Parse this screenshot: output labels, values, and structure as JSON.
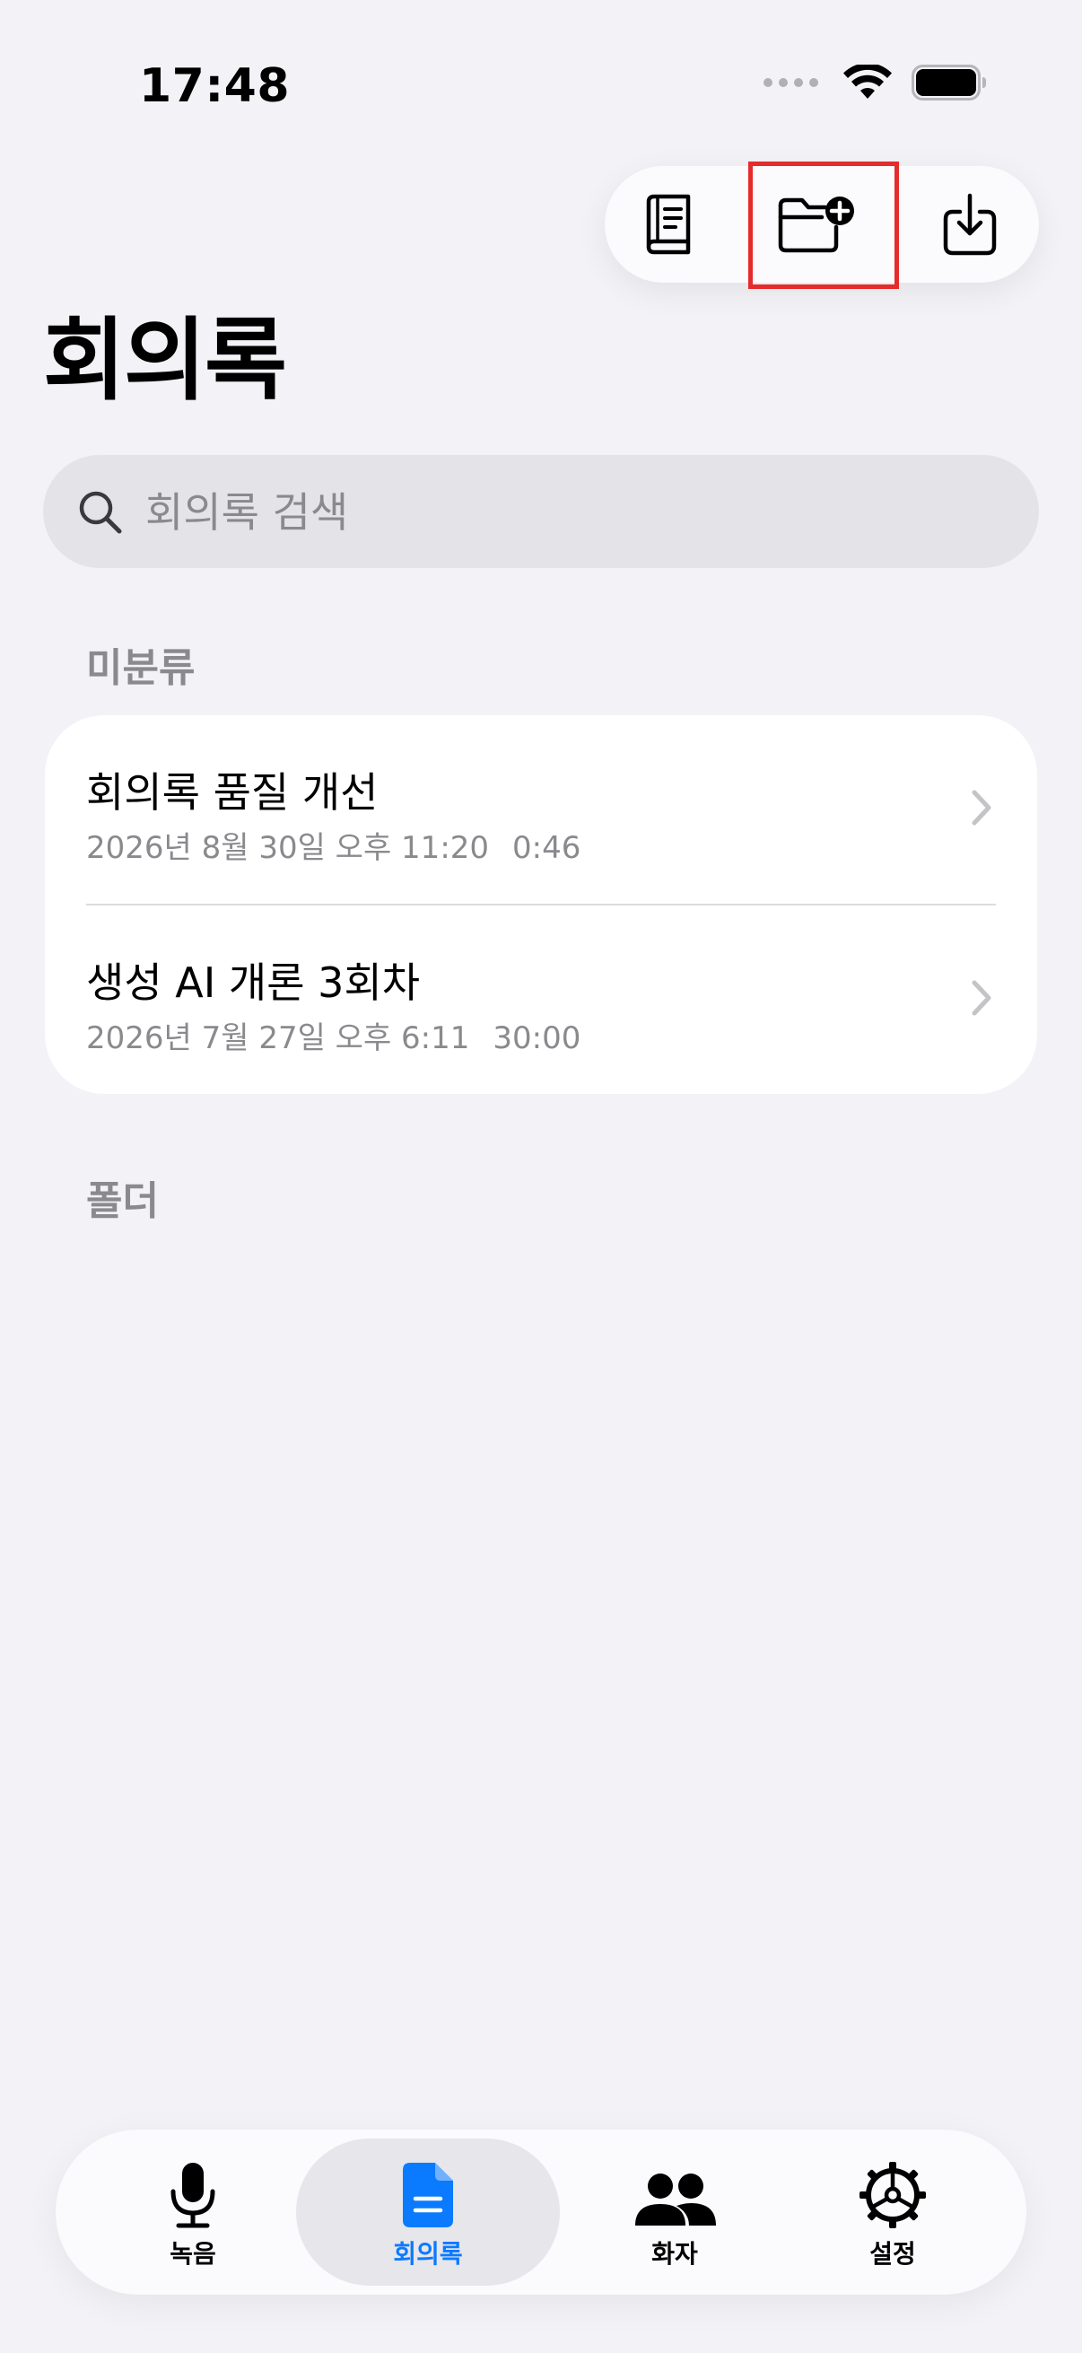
{
  "status_bar": {
    "time": "17:48"
  },
  "toolbar": {
    "buttons": [
      {
        "name": "book-icon"
      },
      {
        "name": "new-folder-icon"
      },
      {
        "name": "download-icon"
      }
    ]
  },
  "page": {
    "title": "회의록"
  },
  "search": {
    "placeholder": "회의록 검색",
    "value": ""
  },
  "sections": {
    "uncategorized": {
      "header": "미분류",
      "items": [
        {
          "title": "회의록 품질 개선",
          "date": "2026년 8월 30일 오후 11:20",
          "duration": "0:46"
        },
        {
          "title": "생성 AI 개론 3회차",
          "date": "2026년 7월 27일 오후 6:11",
          "duration": "30:00"
        }
      ]
    },
    "folders": {
      "header": "폴더"
    }
  },
  "tab_bar": {
    "tabs": [
      {
        "label": "녹음",
        "icon": "mic-icon",
        "selected": false
      },
      {
        "label": "회의록",
        "icon": "document-icon",
        "selected": true
      },
      {
        "label": "화자",
        "icon": "people-icon",
        "selected": false
      },
      {
        "label": "설정",
        "icon": "gear-icon",
        "selected": false
      }
    ]
  },
  "colors": {
    "accent": "#0a7aff",
    "background": "#f2f2f7",
    "secondary_text": "#8a8a8e",
    "highlight": "#e52b2b"
  }
}
